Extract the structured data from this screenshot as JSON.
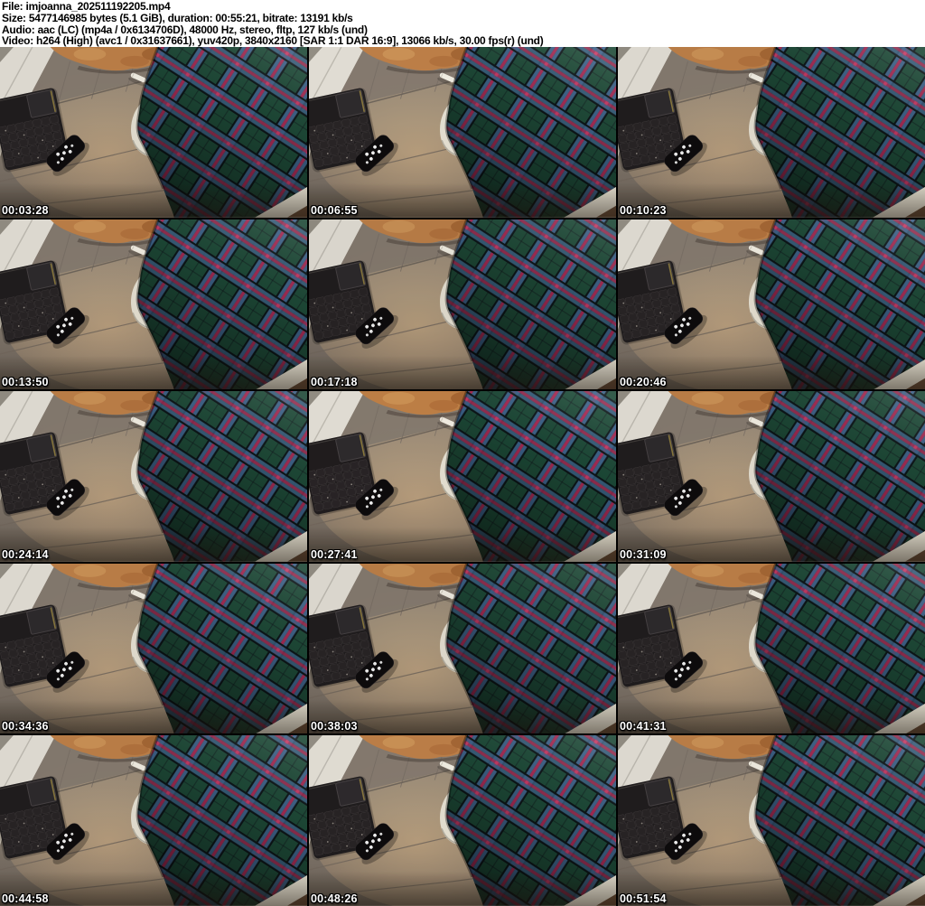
{
  "header": {
    "lines": [
      "File: imjoanna_202511192205.mp4",
      "Size: 5477146985 bytes (5.1 GiB), duration: 00:55:21, bitrate: 13191 kb/s",
      "Audio: aac (LC) (mp4a / 0x6134706D), 48000 Hz, stereo, fltp, 127 kb/s (und)",
      "Video: h264 (High) (avc1 / 0x31637661), yuv420p, 3840x2160 [SAR 1:1 DAR 16:9], 13066 kb/s, 30.00 fps(r) (und)"
    ]
  },
  "grid": {
    "columns": 3,
    "rows": 5,
    "thumbnails": [
      {
        "time": "00:03:28"
      },
      {
        "time": "00:06:55"
      },
      {
        "time": "00:10:23"
      },
      {
        "time": "00:13:50"
      },
      {
        "time": "00:17:18"
      },
      {
        "time": "00:20:46"
      },
      {
        "time": "00:24:14"
      },
      {
        "time": "00:27:41"
      },
      {
        "time": "00:31:09"
      },
      {
        "time": "00:34:36"
      },
      {
        "time": "00:38:03"
      },
      {
        "time": "00:41:31"
      },
      {
        "time": "00:44:58"
      },
      {
        "time": "00:48:26"
      },
      {
        "time": "00:51:54"
      }
    ]
  },
  "scene": {
    "objects": [
      "plaid-blanket",
      "grey-couch",
      "wireless-keyboard",
      "remote-control",
      "tan-fleece-pillow",
      "tile-floor",
      "white-stick-object",
      "sherpa-trim"
    ]
  },
  "colors": {
    "header_background": "#ffffff",
    "header_text": "#000000",
    "timestamp_text": "#ffffff",
    "timestamp_outline": "#000000",
    "plaid_green": "#1d4836",
    "plaid_blue": "#3c5f85",
    "plaid_red": "#a02a52",
    "plaid_black": "#0d1518",
    "couch_grey": "#857a6e",
    "pillow_tan": "#b87c46",
    "trim_white": "#ded9cb",
    "tile_white": "#dcd8cf"
  }
}
